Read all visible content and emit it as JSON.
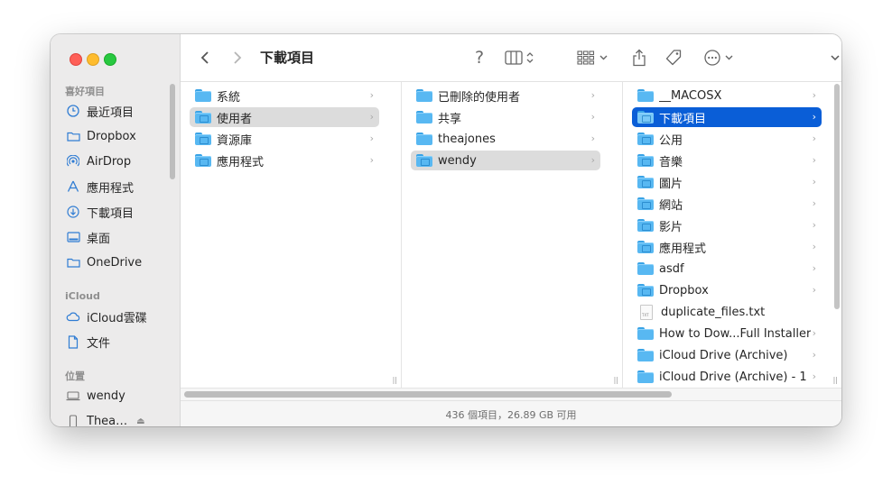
{
  "window": {
    "title": "下載項目"
  },
  "sidebar": {
    "favorites_header": "喜好項目",
    "favorites": [
      {
        "label": "最近項目",
        "icon": "clock-icon"
      },
      {
        "label": "Dropbox",
        "icon": "folder-icon"
      },
      {
        "label": "AirDrop",
        "icon": "airdrop-icon"
      },
      {
        "label": "應用程式",
        "icon": "applications-icon"
      },
      {
        "label": "下載項目",
        "icon": "download-icon"
      },
      {
        "label": "桌面",
        "icon": "desktop-icon"
      },
      {
        "label": "OneDrive",
        "icon": "folder-icon"
      }
    ],
    "icloud_header": "iCloud",
    "icloud": [
      {
        "label": "iCloud雲碟",
        "icon": "cloud-icon"
      },
      {
        "label": "文件",
        "icon": "document-icon"
      }
    ],
    "locations_header": "位置",
    "locations": [
      {
        "label": "wendy",
        "icon": "laptop-icon"
      },
      {
        "label": "Thea…",
        "icon": "phone-icon"
      }
    ]
  },
  "toolbar": {
    "help": "?",
    "view_icon": "columns-view-icon",
    "group_icon": "group-grid-icon",
    "share_icon": "share-icon",
    "tag_icon": "tag-icon",
    "more_icon": "ellipsis-circle-icon",
    "search_icon": "search-icon"
  },
  "columns": [
    {
      "items": [
        {
          "name": "系統",
          "kind": "folder"
        },
        {
          "name": "使用者",
          "kind": "folder",
          "selected": "grey"
        },
        {
          "name": "資源庫",
          "kind": "folder"
        },
        {
          "name": "應用程式",
          "kind": "folder"
        }
      ]
    },
    {
      "items": [
        {
          "name": "已刪除的使用者",
          "kind": "folder"
        },
        {
          "name": "共享",
          "kind": "folder"
        },
        {
          "name": "theajones",
          "kind": "folder"
        },
        {
          "name": "wendy",
          "kind": "folder",
          "selected": "grey"
        }
      ]
    },
    {
      "items": [
        {
          "name": "__MACOSX",
          "kind": "folder"
        },
        {
          "name": "下載項目",
          "kind": "folder",
          "selected": "blue"
        },
        {
          "name": "公用",
          "kind": "folder"
        },
        {
          "name": "音樂",
          "kind": "folder"
        },
        {
          "name": "圖片",
          "kind": "folder"
        },
        {
          "name": "網站",
          "kind": "folder"
        },
        {
          "name": "影片",
          "kind": "folder"
        },
        {
          "name": "應用程式",
          "kind": "folder"
        },
        {
          "name": "asdf",
          "kind": "folder"
        },
        {
          "name": "Dropbox",
          "kind": "folder"
        },
        {
          "name": "duplicate_files.txt",
          "kind": "file",
          "file_label": "TXT"
        },
        {
          "name": "How to Dow...Full Installer",
          "kind": "folder"
        },
        {
          "name": "iCloud Drive (Archive)",
          "kind": "folder"
        },
        {
          "name": "iCloud Drive (Archive) - 1",
          "kind": "folder"
        }
      ]
    }
  ],
  "status_bar": {
    "text": "436 個項目，26.89 GB 可用"
  },
  "colors": {
    "selection_blue": "#0a5ed7",
    "selection_grey": "#dcdcdc",
    "folder_blue": "#58b8f2",
    "close": "#fe5f57",
    "minimize": "#febc2e",
    "zoom": "#28c840"
  }
}
